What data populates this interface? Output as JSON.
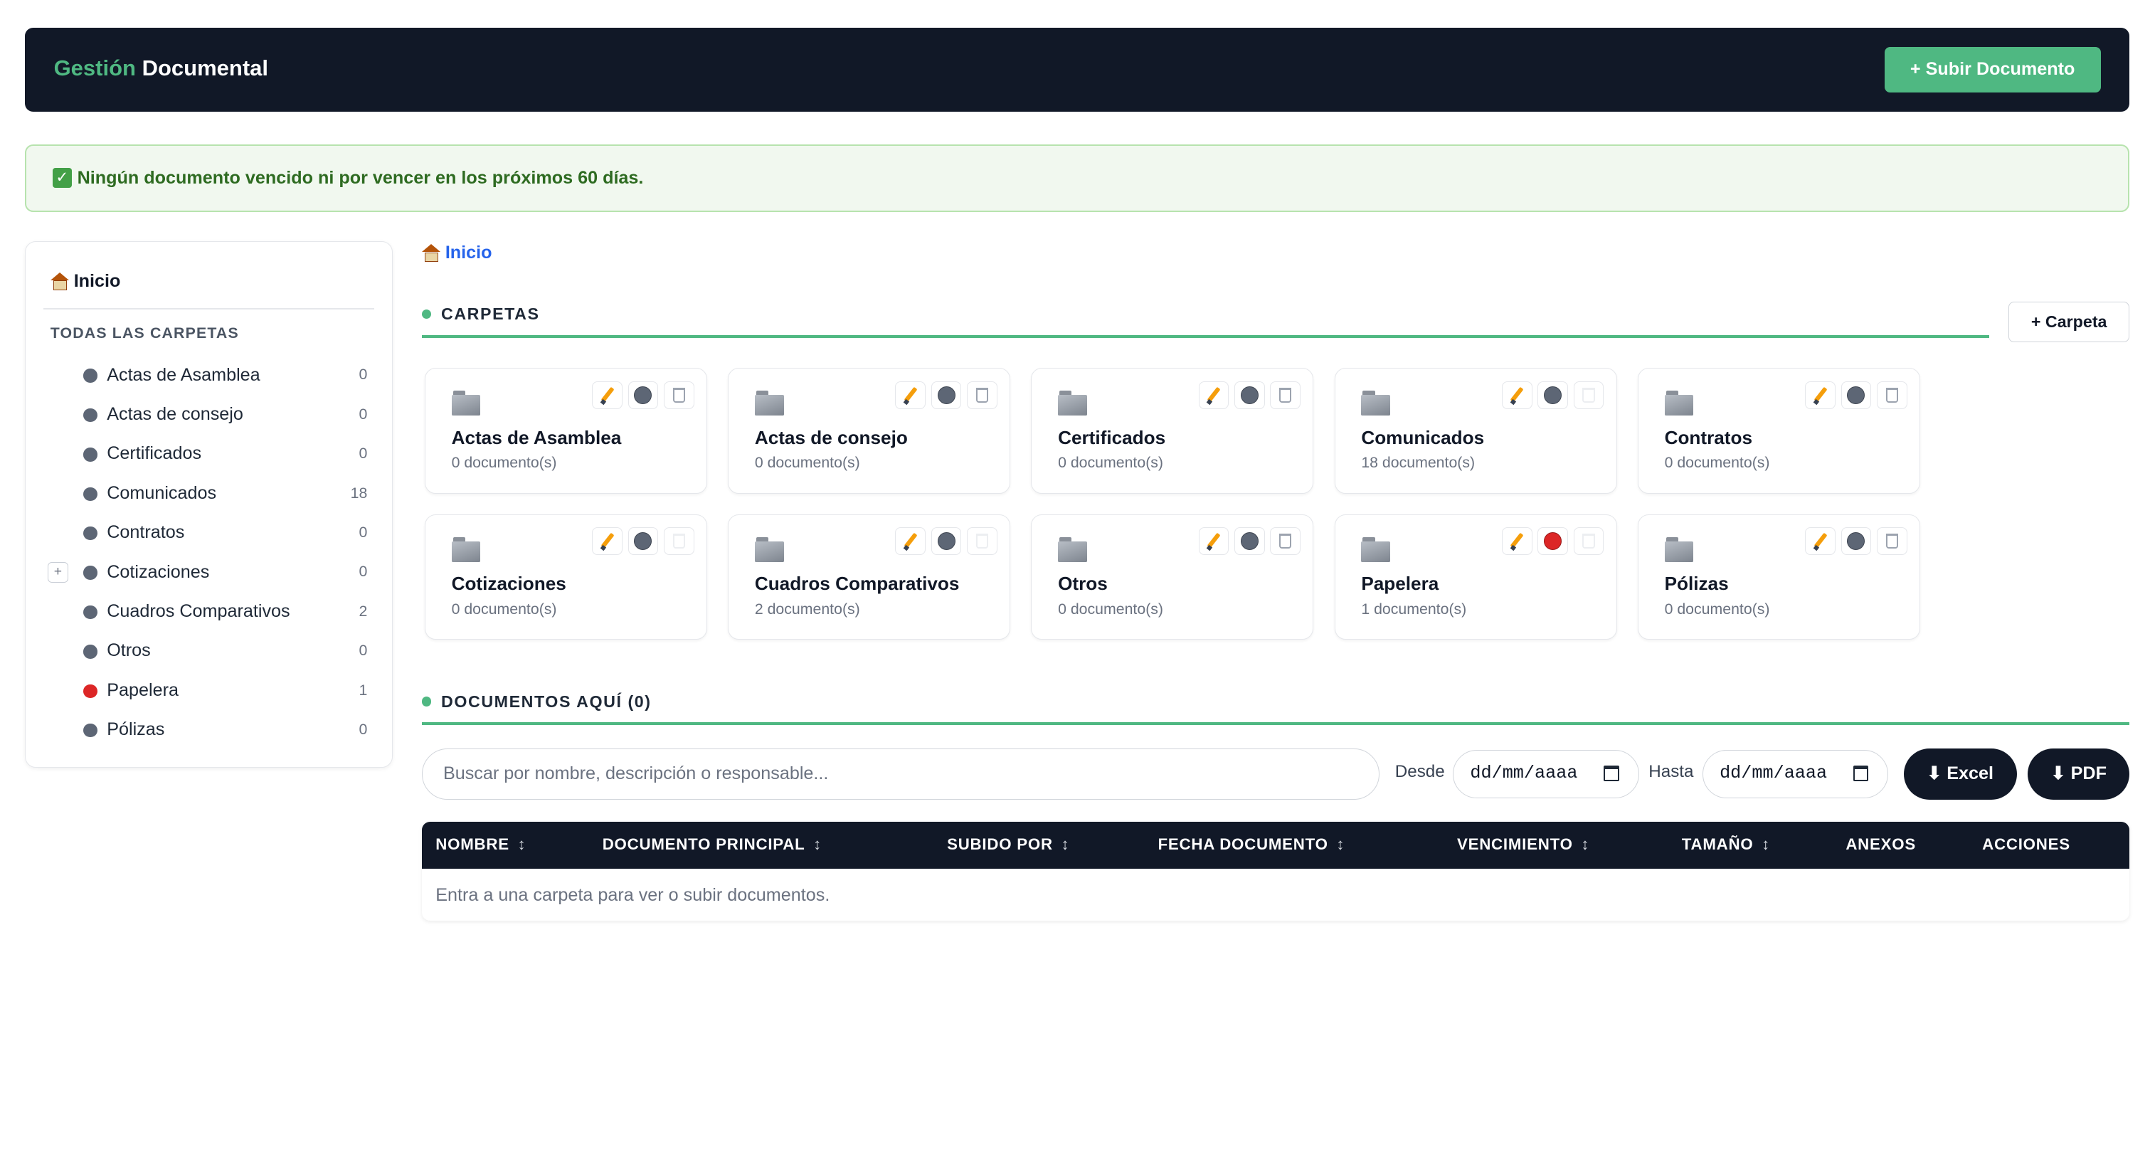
{
  "header": {
    "brand_accent": "Gestión",
    "brand_rest": "Documental",
    "upload_button": "+ Subir Documento"
  },
  "alert": {
    "icon": "check-mark-icon",
    "message": "Ningún documento vencido ni por vencer en los próximos 60 días."
  },
  "sidebar": {
    "home": "Inicio",
    "section_title": "TODAS LAS CARPETAS",
    "items": [
      {
        "label": "Actas de Asamblea",
        "count": "0",
        "color": "#5d6675"
      },
      {
        "label": "Actas de consejo",
        "count": "0",
        "color": "#5d6675"
      },
      {
        "label": "Certificados",
        "count": "0",
        "color": "#5d6675"
      },
      {
        "label": "Comunicados",
        "count": "18",
        "color": "#5d6675"
      },
      {
        "label": "Contratos",
        "count": "0",
        "color": "#5d6675"
      },
      {
        "label": "Cotizaciones",
        "count": "0",
        "color": "#5d6675",
        "expand": "+"
      },
      {
        "label": "Cuadros Comparativos",
        "count": "2",
        "color": "#5d6675"
      },
      {
        "label": "Otros",
        "count": "0",
        "color": "#5d6675"
      },
      {
        "label": "Papelera",
        "count": "1",
        "color": "#dc2626"
      },
      {
        "label": "Pólizas",
        "count": "0",
        "color": "#5d6675"
      }
    ]
  },
  "breadcrumb": {
    "home": "Inicio"
  },
  "folders_section": {
    "title": "CARPETAS",
    "new_folder_button": "+ Carpeta",
    "cards": [
      {
        "name": "Actas de Asamblea",
        "count": "0 documento(s)"
      },
      {
        "name": "Actas de consejo",
        "count": "0 documento(s)"
      },
      {
        "name": "Certificados",
        "count": "0 documento(s)"
      },
      {
        "name": "Comunicados",
        "count": "18 documento(s)"
      },
      {
        "name": "Contratos",
        "count": "0 documento(s)"
      },
      {
        "name": "Cotizaciones",
        "count": "0 documento(s)"
      },
      {
        "name": "Cuadros Comparativos",
        "count": "2 documento(s)"
      },
      {
        "name": "Otros",
        "count": "0 documento(s)"
      },
      {
        "name": "Papelera",
        "count": "1 documento(s)"
      },
      {
        "name": "Pólizas",
        "count": "0 documento(s)"
      }
    ]
  },
  "documents_section": {
    "title": "DOCUMENTOS AQUÍ (0)",
    "search_placeholder": "Buscar por nombre, descripción o responsable...",
    "from_label": "Desde",
    "to_label": "Hasta",
    "date_placeholder": "dd/mm/aaaa",
    "excel_button": "⬇ Excel",
    "pdf_button": "⬇ PDF",
    "columns": [
      "NOMBRE",
      "DOCUMENTO PRINCIPAL",
      "SUBIDO POR",
      "FECHA DOCUMENTO",
      "VENCIMIENTO",
      "TAMAÑO",
      "ANEXOS",
      "ACCIONES"
    ],
    "sort_glyph": "↕",
    "empty_message": "Entra a una carpeta para ver o subir documentos."
  },
  "colors": {
    "accent": "#4fb882",
    "dark": "#111827",
    "link": "#2563eb",
    "folder_dot": "#5d6675",
    "trash_dot": "#dc2626"
  }
}
